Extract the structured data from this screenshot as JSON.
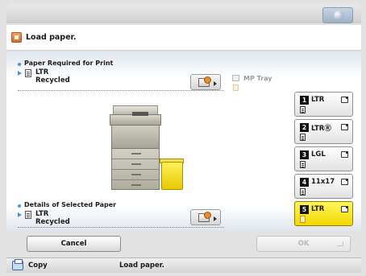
{
  "message": {
    "text": "Load paper."
  },
  "required": {
    "title": "Paper Required for Print",
    "size": "LTR",
    "type": "Recycled"
  },
  "mp_tray": {
    "label": "MP Tray"
  },
  "selected_details": {
    "title": "Details of Selected Paper",
    "size": "LTR",
    "type": "Recycled"
  },
  "drawers": [
    {
      "num": "1",
      "size": "LTR",
      "selected": false
    },
    {
      "num": "2",
      "size": "LTRⓇ",
      "selected": false
    },
    {
      "num": "3",
      "size": "LGL",
      "selected": false
    },
    {
      "num": "4",
      "size": "11x17",
      "selected": false
    },
    {
      "num": "5",
      "size": "LTR",
      "selected": true
    }
  ],
  "buttons": {
    "cancel": "Cancel",
    "ok": "OK"
  },
  "status": {
    "mode": "Copy",
    "message": "Load paper."
  },
  "colors": {
    "accent": "#4f8fd6",
    "selected_drawer": "#f2d900"
  }
}
